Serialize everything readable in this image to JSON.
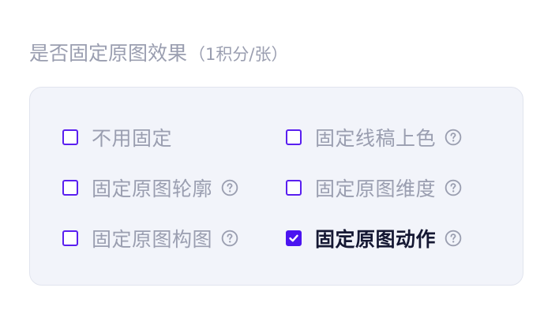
{
  "section": {
    "title": "是否固定原图效果",
    "note": "（1积分/张）"
  },
  "options": [
    {
      "label": "不用固定",
      "checked": false,
      "help": false
    },
    {
      "label": "固定线稿上色",
      "checked": false,
      "help": true
    },
    {
      "label": "固定原图轮廓",
      "checked": false,
      "help": true
    },
    {
      "label": "固定原图维度",
      "checked": false,
      "help": true
    },
    {
      "label": "固定原图构图",
      "checked": false,
      "help": true
    },
    {
      "label": "固定原图动作",
      "checked": true,
      "help": true
    }
  ],
  "colors": {
    "accent": "#4b14f0",
    "muted_text": "#9a9eb0",
    "selected_text": "#151833",
    "panel_bg": "#f2f4fa"
  },
  "icons": {
    "help": "question-circle-icon",
    "check": "checkmark-icon"
  }
}
